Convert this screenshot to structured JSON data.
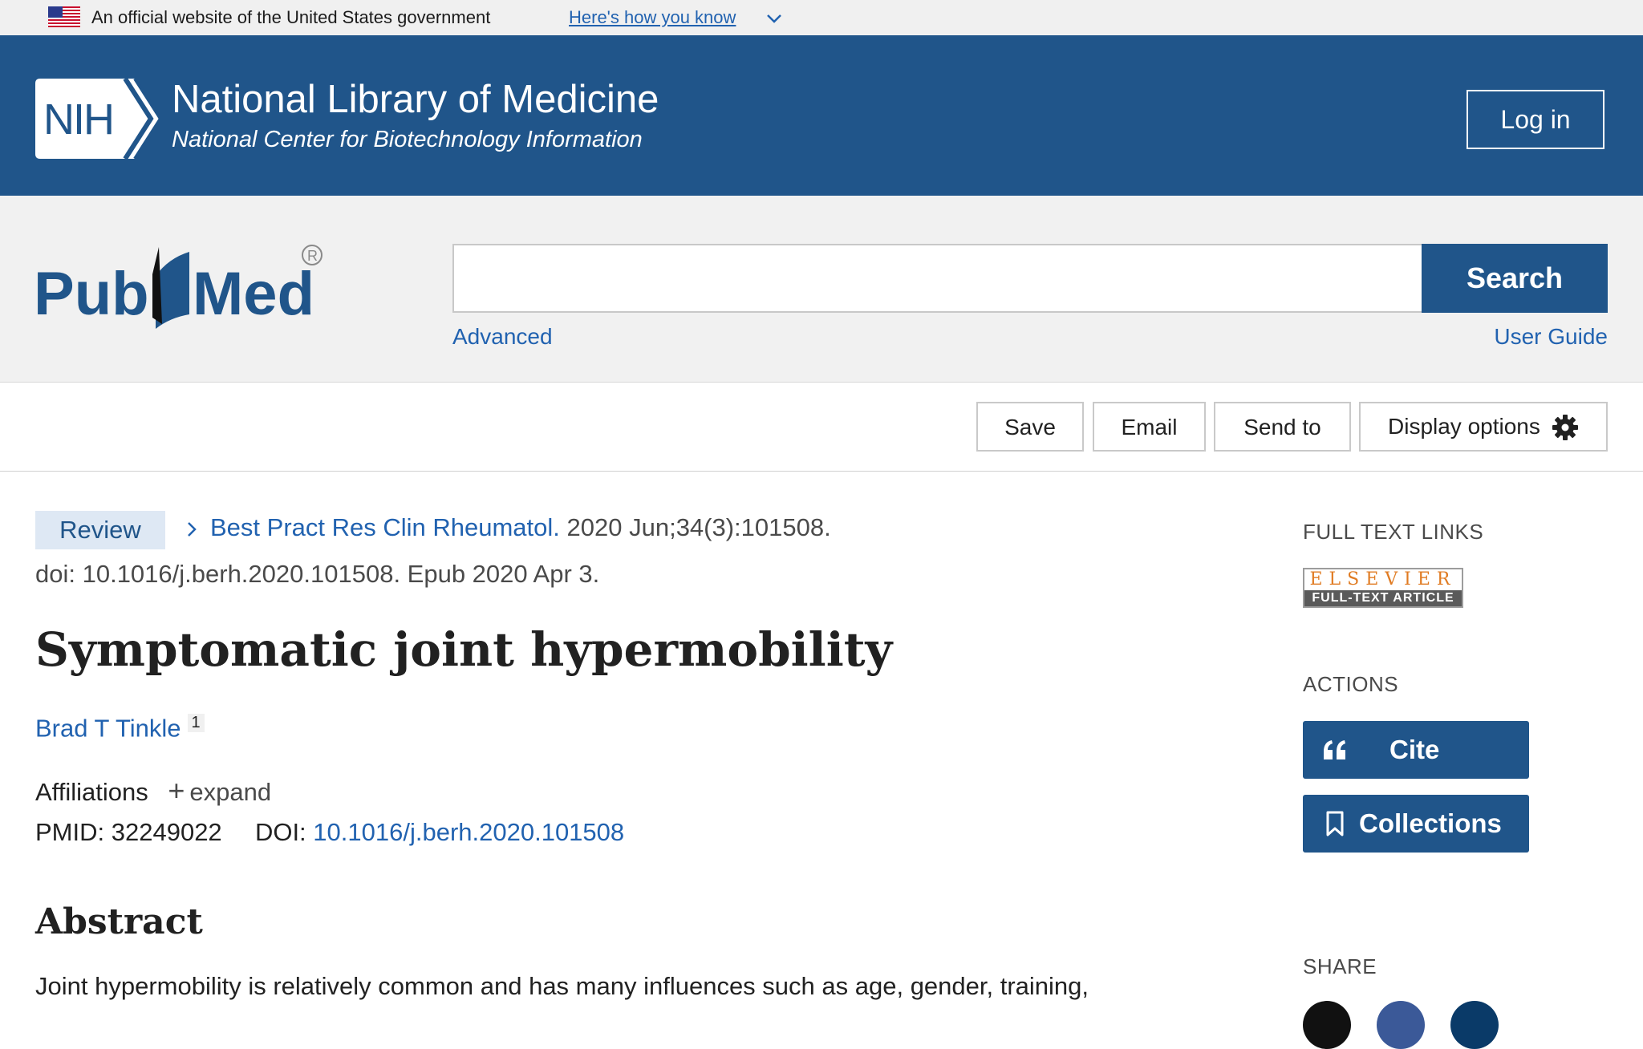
{
  "gov_banner": {
    "text": "An official website of the United States government",
    "link": "Here's how you know"
  },
  "header": {
    "logo_text": "NIH",
    "title": "National Library of Medicine",
    "subtitle": "National Center for Biotechnology Information",
    "login_label": "Log in"
  },
  "search": {
    "logo_text": "PubMed",
    "input_value": "",
    "button_label": "Search",
    "advanced_label": "Advanced",
    "guide_label": "User Guide"
  },
  "toolbar": {
    "save_label": "Save",
    "email_label": "Email",
    "send_to_label": "Send to",
    "display_options_label": "Display options"
  },
  "article": {
    "type_badge": "Review",
    "journal": "Best Pract Res Clin Rheumatol.",
    "citation": " 2020 Jun;34(3):101508.",
    "doi_line": "doi: 10.1016/j.berh.2020.101508. Epub 2020 Apr 3.",
    "title": "Symptomatic joint hypermobility",
    "author": "Brad T Tinkle",
    "author_sup": "1",
    "affiliations_label": "Affiliations",
    "expand_label": "expand",
    "pmid_label": "PMID:",
    "pmid": "32249022",
    "doi_label": "DOI:",
    "doi": "10.1016/j.berh.2020.101508",
    "abstract_heading": "Abstract",
    "abstract_text": "Joint hypermobility is relatively common and has many influences such as age, gender, training,"
  },
  "sidebar": {
    "full_text_heading": "FULL TEXT LINKS",
    "elsevier_top": "ELSEVIER",
    "elsevier_bottom": "FULL-TEXT ARTICLE",
    "actions_heading": "ACTIONS",
    "cite_label": "Cite",
    "collections_label": "Collections",
    "share_heading": "SHARE"
  },
  "colors": {
    "brand_blue": "#20558a",
    "link_blue": "#2162b0",
    "badge_bg": "#dee8f4"
  },
  "icons": [
    "us-flag-icon",
    "chevron-down-icon",
    "nih-logo-icon",
    "pubmed-logo-icon",
    "gear-icon",
    "chevron-right-icon",
    "quote-icon",
    "bookmark-icon",
    "twitter-icon",
    "facebook-icon",
    "linkedin-icon"
  ]
}
